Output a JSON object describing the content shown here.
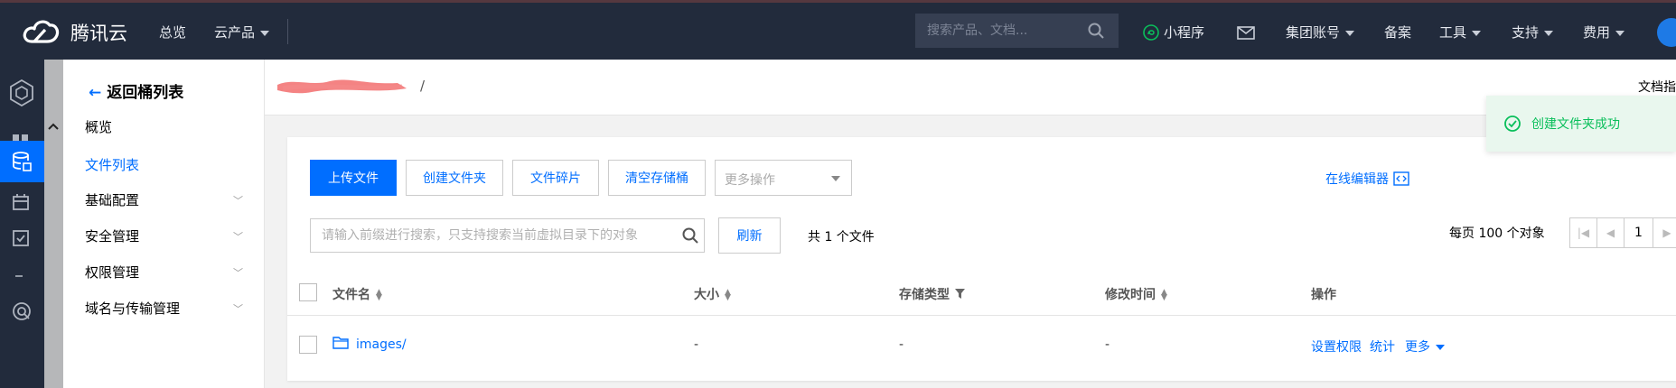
{
  "topbar": {
    "brand": "腾讯云",
    "nav": {
      "overview": "总览",
      "products": "云产品"
    },
    "search_placeholder": "搜索产品、文档...",
    "items": {
      "miniprogram": "小程序",
      "group_account": "集团账号",
      "icp": "备案",
      "tools": "工具",
      "support": "支持",
      "billing": "费用"
    }
  },
  "menu": {
    "back": "返回桶列表",
    "items": [
      {
        "label": "概览"
      },
      {
        "label": "文件列表"
      },
      {
        "label": "基础配置"
      },
      {
        "label": "安全管理"
      },
      {
        "label": "权限管理"
      },
      {
        "label": "域名与传输管理"
      }
    ],
    "active_index": 1
  },
  "crumbs": {
    "slash": "/",
    "doc_link": "文档指引"
  },
  "toast": {
    "message": "创建文件夹成功"
  },
  "toolbar": {
    "upload": "上传文件",
    "create_folder": "创建文件夹",
    "fragments": "文件碎片",
    "empty_bucket": "清空存储桶",
    "more_actions": "更多操作",
    "online_editor": "在线编辑器"
  },
  "filter": {
    "search_placeholder": "请输入前缀进行搜索，只支持搜索当前虚拟目录下的对象",
    "refresh": "刷新",
    "count": "共 1 个文件",
    "per_page": "每页 100 个对象",
    "page": "1"
  },
  "table": {
    "columns": {
      "name": "文件名",
      "size": "大小",
      "storage": "存储类型",
      "modified": "修改时间",
      "ops": "操作"
    },
    "rows": [
      {
        "name": "images/",
        "size": "-",
        "storage": "-",
        "modified": "-",
        "actions": {
          "perm": "设置权限",
          "stats": "统计",
          "more": "更多"
        }
      }
    ]
  },
  "colors": {
    "accent": "#006eff",
    "topbar": "#222b3c",
    "success": "#0abf5b"
  }
}
